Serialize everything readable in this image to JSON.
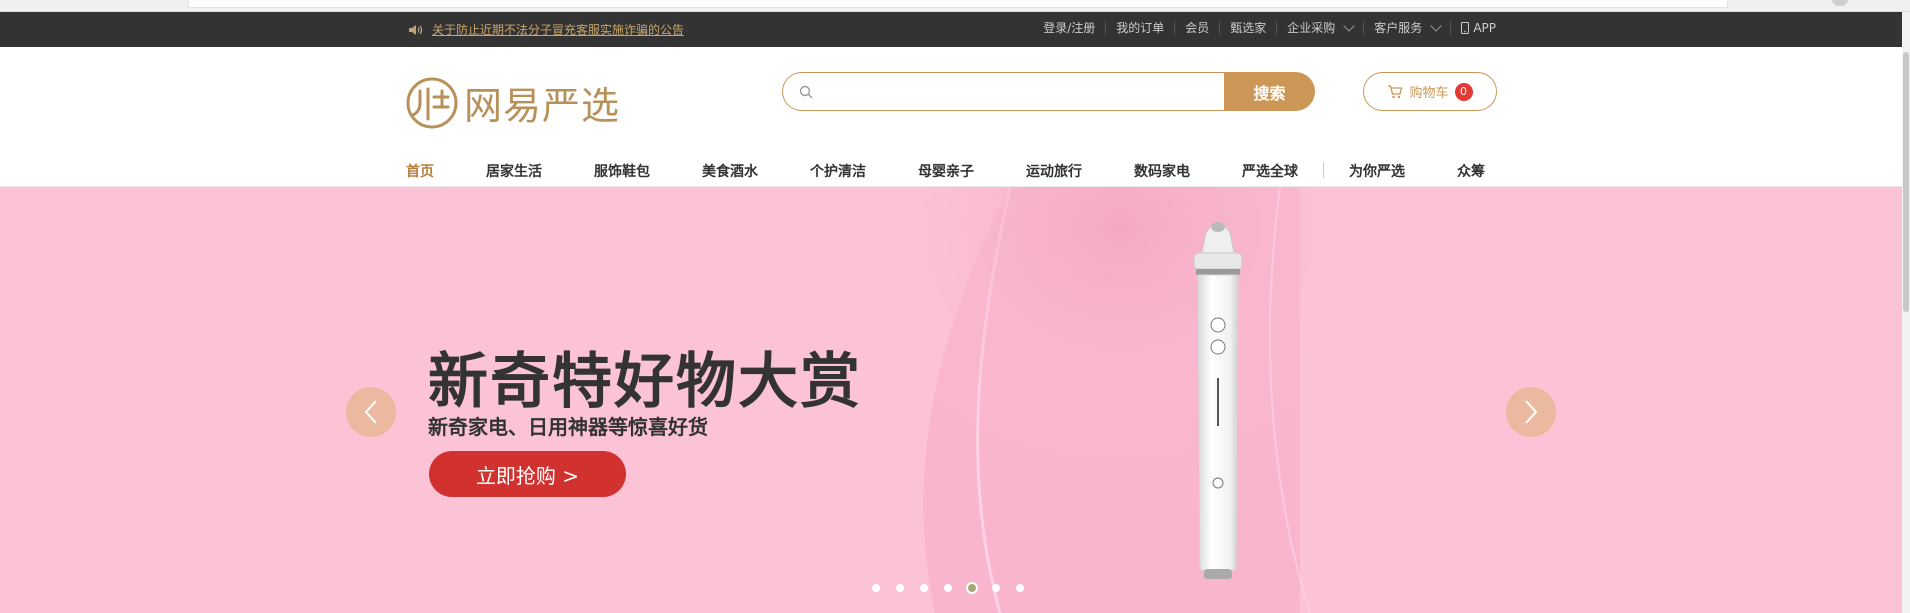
{
  "topbar": {
    "notice": "关于防止近期不法分子冒充客服实施诈骗的公告",
    "links": [
      {
        "label": "登录/注册"
      },
      {
        "label": "我的订单"
      },
      {
        "label": "会员"
      },
      {
        "label": "甄选家"
      },
      {
        "label": "企业采购"
      },
      {
        "label": "客户服务"
      },
      {
        "label": "APP"
      }
    ]
  },
  "header": {
    "logo_text": "网易严选",
    "search": {
      "placeholder": "",
      "button": "搜索"
    },
    "cart": {
      "label": "购物车",
      "count": "0"
    }
  },
  "nav": {
    "items": [
      "首页",
      "居家生活",
      "服饰鞋包",
      "美食酒水",
      "个护清洁",
      "母婴亲子",
      "运动旅行",
      "数码家电",
      "严选全球",
      "为你严选",
      "众筹"
    ],
    "active_index": 0
  },
  "banner": {
    "title": "新奇特好物大赏",
    "subtitle": "新奇家电、日用神器等惊喜好货",
    "cta": "立即抢购 >",
    "slide_count": 7,
    "active_slide": 5
  },
  "colors": {
    "accent": "#cc9756",
    "topbar_bg": "#333333",
    "banner_bg": "#fcc3d6",
    "cta_bg": "#d1312f",
    "badge_bg": "#e53935"
  },
  "icons": {
    "notice": "speaker-icon",
    "search": "search-icon",
    "cart": "cart-icon",
    "app": "phone-icon",
    "prev": "chevron-left-icon",
    "next": "chevron-right-icon"
  }
}
